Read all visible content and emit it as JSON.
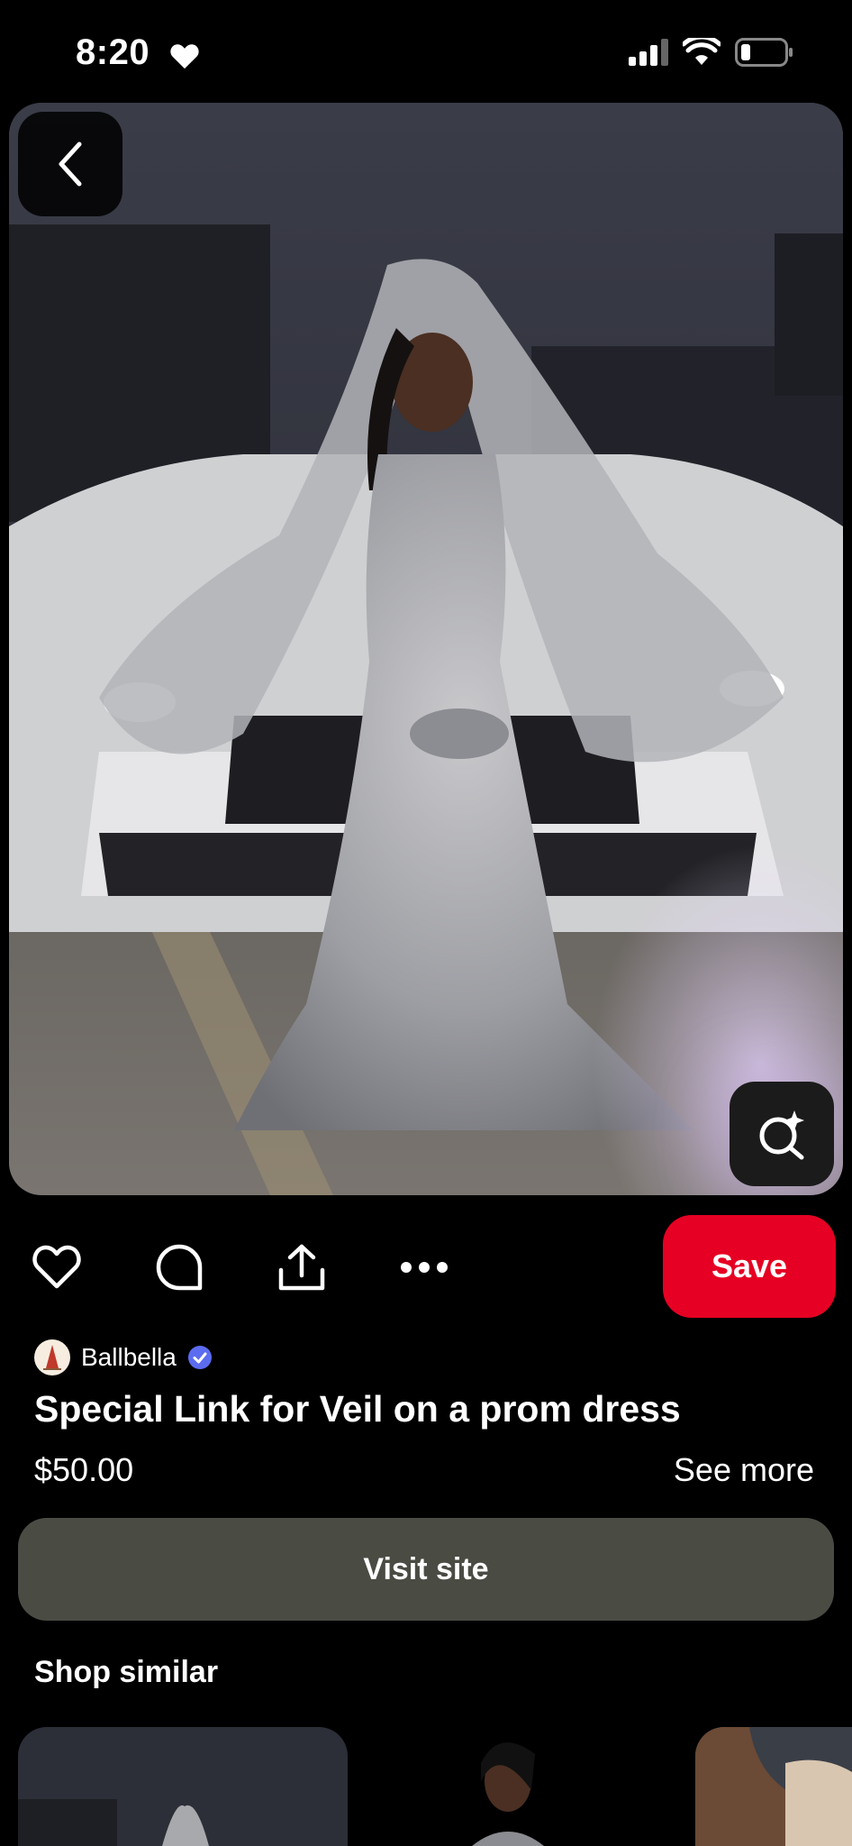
{
  "status_bar": {
    "time": "8:20"
  },
  "pin": {
    "creator_name": "Ballbella",
    "title": "Special Link for Veil on a prom dress",
    "price": "$50.00",
    "see_more_label": "See more",
    "save_label": "Save",
    "visit_label": "Visit site"
  },
  "shop_similar": {
    "heading": "Shop similar"
  },
  "colors": {
    "save": "#e60023",
    "visit": "#4a4c44",
    "verified": "#5b6cf0"
  }
}
